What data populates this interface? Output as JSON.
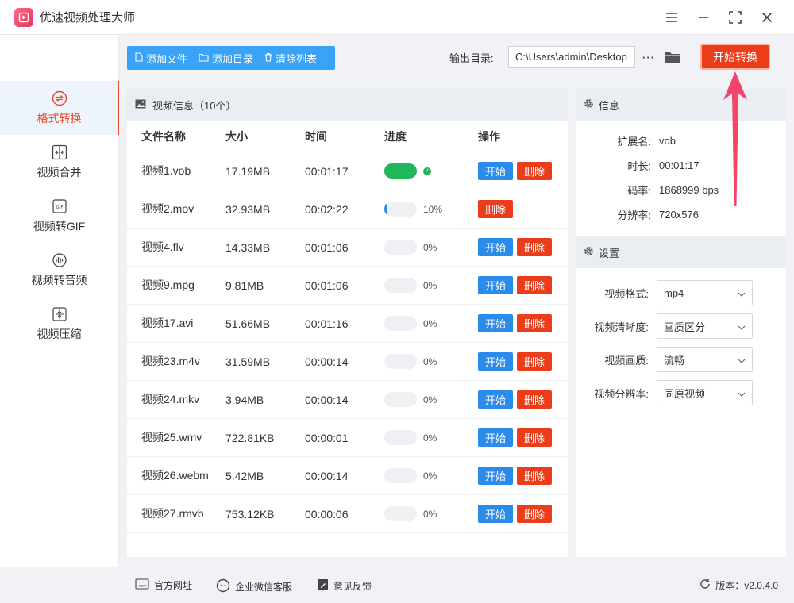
{
  "app": {
    "title": "优速视频处理大师"
  },
  "sidebar": {
    "items": [
      {
        "label": "格式转换",
        "icon": "format-convert-icon",
        "active": true
      },
      {
        "label": "视频合并",
        "icon": "merge-icon"
      },
      {
        "label": "视频转GIF",
        "icon": "gif-icon"
      },
      {
        "label": "视频转音频",
        "icon": "audio-icon"
      },
      {
        "label": "视频压缩",
        "icon": "compress-icon"
      }
    ]
  },
  "toolbar": {
    "add_file": "添加文件",
    "add_dir": "添加目录",
    "clear_list": "清除列表",
    "output_label": "输出目录:",
    "output_path": "C:\\Users\\admin\\Desktop",
    "more": "···",
    "start_all": "开始转换"
  },
  "list": {
    "title": "视频信息（10个）",
    "columns": [
      "文件名称",
      "大小",
      "时间",
      "进度",
      "操作"
    ],
    "start_label": "开始",
    "delete_label": "删除",
    "rows": [
      {
        "name": "视频1.vob",
        "size": "17.19MB",
        "time": "00:01:17",
        "progress": 100,
        "progress_text": "",
        "done": true,
        "show_start": true
      },
      {
        "name": "视频2.mov",
        "size": "32.93MB",
        "time": "00:02:22",
        "progress": 10,
        "progress_text": "10%",
        "done": false,
        "show_start": false
      },
      {
        "name": "视频4.flv",
        "size": "14.33MB",
        "time": "00:01:06",
        "progress": 0,
        "progress_text": "0%",
        "done": false,
        "show_start": true
      },
      {
        "name": "视频9.mpg",
        "size": "9.81MB",
        "time": "00:01:06",
        "progress": 0,
        "progress_text": "0%",
        "done": false,
        "show_start": true
      },
      {
        "name": "视频17.avi",
        "size": "51.66MB",
        "time": "00:01:16",
        "progress": 0,
        "progress_text": "0%",
        "done": false,
        "show_start": true
      },
      {
        "name": "视频23.m4v",
        "size": "31.59MB",
        "time": "00:00:14",
        "progress": 0,
        "progress_text": "0%",
        "done": false,
        "show_start": true
      },
      {
        "name": "视频24.mkv",
        "size": "3.94MB",
        "time": "00:00:14",
        "progress": 0,
        "progress_text": "0%",
        "done": false,
        "show_start": true
      },
      {
        "name": "视频25.wmv",
        "size": "722.81KB",
        "time": "00:00:01",
        "progress": 0,
        "progress_text": "0%",
        "done": false,
        "show_start": true
      },
      {
        "name": "视频26.webm",
        "size": "5.42MB",
        "time": "00:00:14",
        "progress": 0,
        "progress_text": "0%",
        "done": false,
        "show_start": true
      },
      {
        "name": "视频27.rmvb",
        "size": "753.12KB",
        "time": "00:00:06",
        "progress": 0,
        "progress_text": "0%",
        "done": false,
        "show_start": true
      }
    ]
  },
  "info": {
    "title": "信息",
    "rows": [
      {
        "key": "扩展名:",
        "value": "vob"
      },
      {
        "key": "时长:",
        "value": "00:01:17"
      },
      {
        "key": "码率:",
        "value": "1868999 bps"
      },
      {
        "key": "分辨率:",
        "value": "720x576"
      }
    ]
  },
  "settings": {
    "title": "设置",
    "rows": [
      {
        "key": "视频格式:",
        "value": "mp4"
      },
      {
        "key": "视频清晰度:",
        "value": "画质区分"
      },
      {
        "key": "视频画质:",
        "value": "流畅"
      },
      {
        "key": "视频分辨率:",
        "value": "同原视频"
      }
    ]
  },
  "footer": {
    "website": "官方网址",
    "wechat": "企业微信客服",
    "feedback": "意见反馈",
    "version": "版本：v2.0.4.0"
  },
  "colors": {
    "accent_blue": "#2a8bea",
    "accent_red": "#ec3d1b",
    "success": "#20b65a",
    "toolbar_blue": "#3aa3f7"
  }
}
